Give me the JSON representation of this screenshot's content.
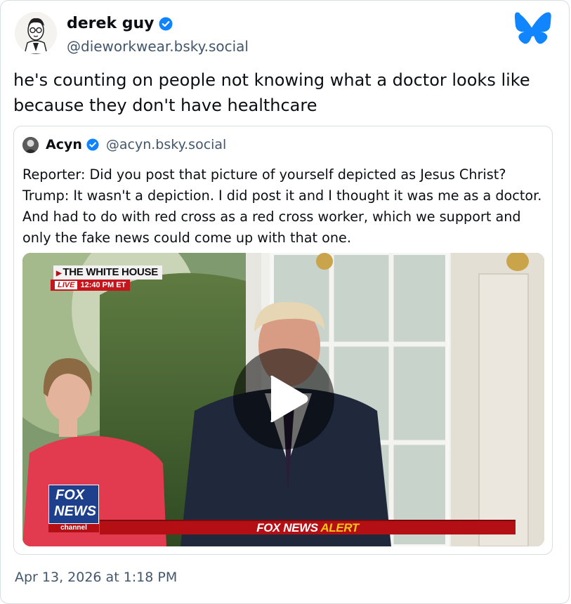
{
  "post": {
    "author_name": "derek guy",
    "author_handle": "@dieworkwear.bsky.social",
    "text": "he's counting on people not knowing what a doctor looks like because they don't have healthcare",
    "timestamp": "Apr 13, 2026 at 1:18 PM"
  },
  "quote": {
    "author_name": "Acyn",
    "author_handle": "@acyn.bsky.social",
    "text": "Reporter: Did you post that picture of yourself depicted as Jesus Christ? Trump: It wasn't a depiction. I did post it and I thought it was me as a doctor. And had to do with red cross as a red cross worker, which we support and only the fake news could come up with that one."
  },
  "video": {
    "location_banner": "THE WHITE HOUSE",
    "live_label": "LIVE",
    "time_label": "12:40 PM ET",
    "alert_prefix": "FOX NEWS",
    "alert_word": "ALERT",
    "channel_logo_line1": "FOX",
    "channel_logo_line2": "NEWS",
    "channel_logo_line3": "channel",
    "play_icon": "play-icon"
  },
  "icons": {
    "verified": "verified-check-icon",
    "platform": "bluesky-butterfly-icon"
  },
  "colors": {
    "brand_blue": "#1185fe",
    "verified_blue": "#1083fe",
    "handle_gray": "#42576c",
    "border": "#d8dde3",
    "fox_red": "#b40f15",
    "alert_yellow": "#f4c518"
  }
}
